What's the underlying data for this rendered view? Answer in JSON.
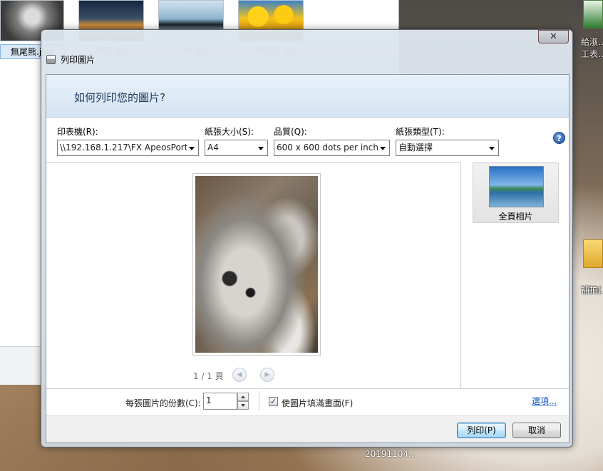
{
  "explorer": {
    "selected_caption": "無尾熊.jpg",
    "captions": [
      "燈塔.jpg",
      "企鵝.jpg",
      "鬱金香.jpg"
    ]
  },
  "desktop": {
    "excel_label_line1": "給淑…",
    "excel_label_line2": "工表…",
    "folder_label": "補拍(…",
    "taskbar_text": "20191104..."
  },
  "dialog": {
    "title": "列印圖片",
    "close_glyph": "✕",
    "heading": "如何列印您的圖片?",
    "printer": {
      "label": "印表機(R):",
      "value": "\\\\192.168.1.217\\FX ApeosPort-V"
    },
    "paper_size": {
      "label": "紙張大小(S):",
      "value": "A4"
    },
    "quality": {
      "label": "品質(Q):",
      "value": "600 x 600 dots per inch"
    },
    "paper_type": {
      "label": "紙張類型(T):",
      "value": "自動選擇"
    },
    "help_glyph": "?",
    "preview": {
      "page_indicator": "1 / 1 頁",
      "prev_glyph": "◀",
      "next_glyph": "▶"
    },
    "layout": {
      "item_label": "全頁相片"
    },
    "copies": {
      "label": "每張圖片的份數(C):",
      "value": "1"
    },
    "fit_checkbox": {
      "label": "使圖片填滿畫面(F)",
      "checked": true,
      "glyph": "✓"
    },
    "options_link": "選項...",
    "print_button": "列印(P)",
    "cancel_button": "取消"
  }
}
